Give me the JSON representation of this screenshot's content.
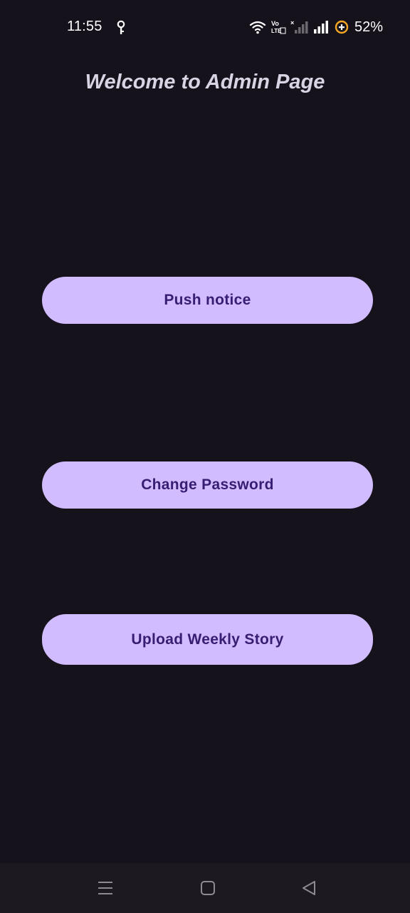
{
  "status_bar": {
    "time": "11:55",
    "battery_percent": "52%",
    "icons": [
      "key-icon",
      "wifi-icon",
      "volte-icon",
      "signal-sim2-icon",
      "signal-sim1-icon",
      "battery-saver-icon"
    ],
    "accent": "#f5a623"
  },
  "header": {
    "title": "Welcome to Admin Page"
  },
  "actions": {
    "push_notice": "Push notice",
    "change_password": "Change Password",
    "upload_weekly_story": "Upload Weekly Story"
  },
  "nav_bar": {
    "icons": [
      "menu-icon",
      "home-icon",
      "back-icon"
    ]
  },
  "colors": {
    "background": "#15121b",
    "button_bg": "#d0bcff",
    "button_text": "#381e72",
    "title_text": "#d9d3e3"
  }
}
